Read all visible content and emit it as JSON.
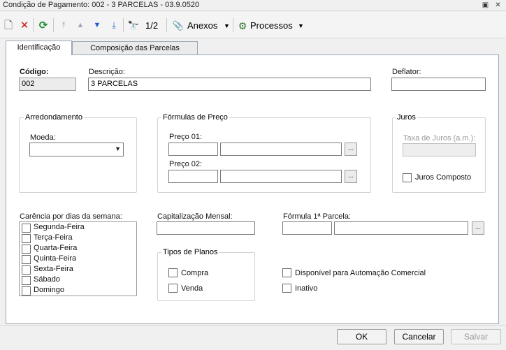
{
  "window": {
    "title": "Condição de Pagamento: 002 - 3 PARCELAS - 03.9.0520",
    "restore_glyph": "▣",
    "close_glyph": "✕"
  },
  "toolbar": {
    "icons": {
      "new": "🗋",
      "delete": "✕",
      "refresh": "⟳",
      "first": "⤒",
      "prev": "▲",
      "next": "▼",
      "last": "⤓",
      "find": "🔭"
    },
    "record_position": "1/2",
    "anexos_icon": "📎",
    "anexos_label": "Anexos",
    "processos_icon": "⚙",
    "processos_label": "Processos",
    "dropdown_glyph": "▼"
  },
  "tabs": [
    {
      "label": "Identificação"
    },
    {
      "label": "Composição das Parcelas"
    }
  ],
  "form": {
    "codigo": {
      "label": "Código:",
      "value": "002"
    },
    "descricao": {
      "label": "Descrição:",
      "value": "3 PARCELAS"
    },
    "deflator": {
      "label": "Deflator:",
      "value": ""
    },
    "arredondamento": {
      "title": "Arredondamento",
      "moeda_label": "Moeda:",
      "moeda_value": "",
      "arrow_glyph": "▼"
    },
    "formulas": {
      "title": "Fórmulas de Preço",
      "preco01_label": "Preço 01:",
      "preco02_label": "Preço 02:",
      "preco01_code": "",
      "preco01_formula": "",
      "preco02_code": "",
      "preco02_formula": "",
      "lookup_glyph": "..."
    },
    "juros": {
      "title": "Juros",
      "taxa_label": "Taxa de Juros (a.m.):",
      "taxa_value": "",
      "composto_label": "Juros Composto",
      "composto_checked": false
    },
    "carencia": {
      "label": "Carência por dias da semana:",
      "days": [
        {
          "label": "Segunda-Feira",
          "checked": false
        },
        {
          "label": "Terça-Feira",
          "checked": false
        },
        {
          "label": "Quarta-Feira",
          "checked": false
        },
        {
          "label": "Quinta-Feira",
          "checked": false
        },
        {
          "label": "Sexta-Feira",
          "checked": false
        },
        {
          "label": "Sábado",
          "checked": false
        },
        {
          "label": "Domingo",
          "checked": false
        }
      ]
    },
    "capitalizacao": {
      "label": "Capitalização Mensal:",
      "value": ""
    },
    "formula_parcela": {
      "label": "Fórmula 1ª Parcela:",
      "code": "",
      "formula": "",
      "lookup_glyph": "..."
    },
    "tipos_planos": {
      "title": "Tipos de Planos",
      "compra_label": "Compra",
      "venda_label": "Venda"
    },
    "disponivel_label": "Disponível para Automação Comercial",
    "inativo_label": "Inativo"
  },
  "footer": {
    "ok_label": "OK",
    "cancelar_label": "Cancelar",
    "salvar_label": "Salvar"
  },
  "colors": {
    "delete_icon": "#d01818",
    "refresh_icon": "#1a8a2a",
    "nav_disabled": "#9aa8b8",
    "nav_enabled": "#1f5fc8",
    "panel_border": "#9aa6b0"
  }
}
